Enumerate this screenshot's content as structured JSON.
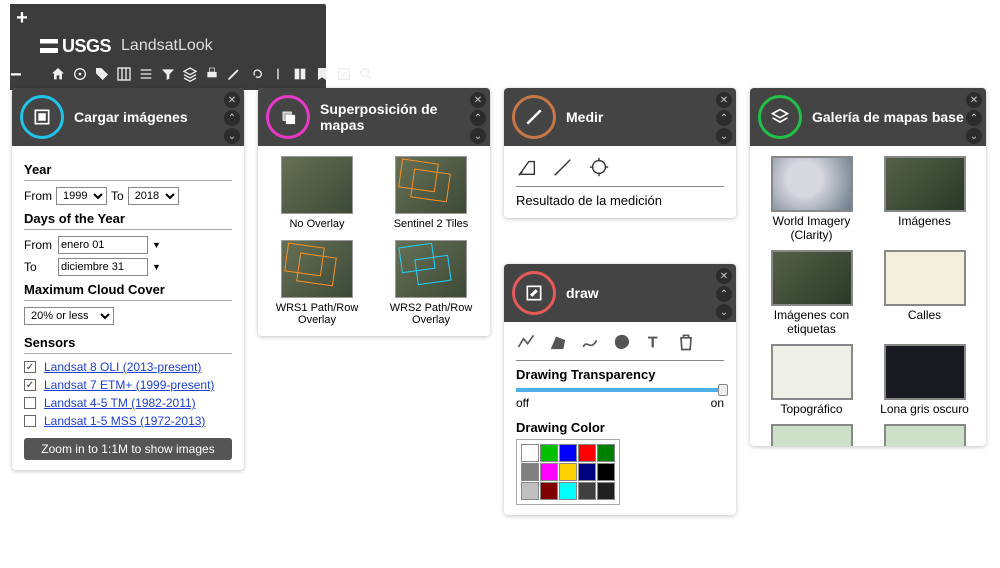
{
  "app": {
    "logo_text": "USGS",
    "title": "LandsatLook"
  },
  "cargar": {
    "title": "Cargar imágenes",
    "year_label": "Year",
    "from": "From",
    "to": "To",
    "year_from": "1999",
    "year_to": "2018",
    "days_label": "Days of the Year",
    "day_from": "enero 01",
    "day_to": "diciembre 31",
    "cloud_label": "Maximum Cloud Cover",
    "cloud_value": "20% or less",
    "sensors_label": "Sensors",
    "sensors": [
      {
        "label": "Landsat 8 OLI (2013-present)",
        "checked": true
      },
      {
        "label": "Landsat 7 ETM+ (1999-present)",
        "checked": true
      },
      {
        "label": "Landsat 4-5 TM (1982-2011)",
        "checked": false
      },
      {
        "label": "Landsat 1-5 MSS (1972-2013)",
        "checked": false
      }
    ],
    "zoom_msg": "Zoom in to 1:1M to show images"
  },
  "overlay": {
    "title": "Superposición de mapas",
    "items": [
      "No Overlay",
      "Sentinel 2 Tiles",
      "WRS1 Path/Row Overlay",
      "WRS2 Path/Row Overlay"
    ]
  },
  "measure": {
    "title": "Medir",
    "result_label": "Resultado de la medición"
  },
  "draw": {
    "title": "draw",
    "transparency_label": "Drawing Transparency",
    "off": "off",
    "on": "on",
    "color_label": "Drawing Color",
    "swatches": [
      "#ffffff",
      "#00c000",
      "#0000ff",
      "#ff0000",
      "#008000",
      "#808080",
      "#ff00ff",
      "#ffd000",
      "#000080",
      "#000000",
      "#c0c0c0",
      "#800000",
      "#00ffff",
      "#404040",
      "#202020"
    ]
  },
  "basemap": {
    "title": "Galería de mapas base",
    "items": [
      "World Imagery (Clarity)",
      "Imágenes",
      "Imágenes con etiquetas",
      "Calles",
      "Topográfico",
      "Lona gris oscuro"
    ]
  }
}
